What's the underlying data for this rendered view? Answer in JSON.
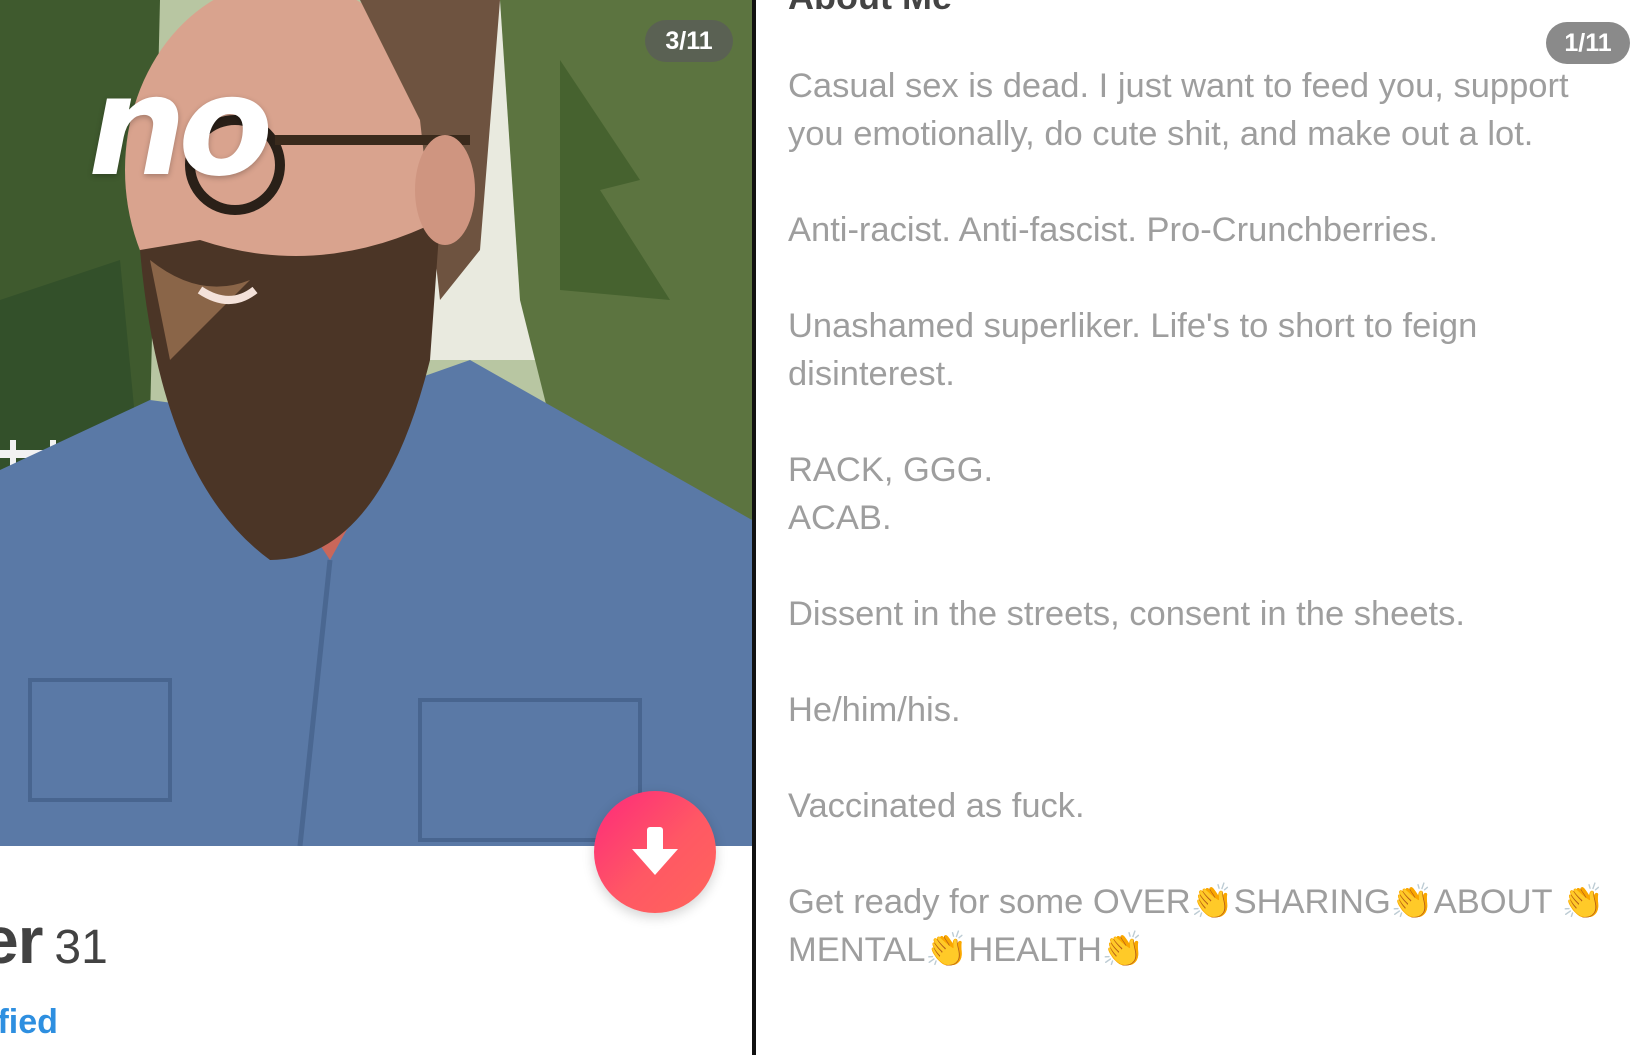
{
  "left_card": {
    "sticker_text": "no",
    "photo_counter": "3/11",
    "name_fragment": "er",
    "age": "31",
    "verified_fragment": "ified"
  },
  "right_card": {
    "heading": "About Me",
    "bio_counter": "1/11",
    "bio_paragraphs": [
      "Casual sex is dead. I just want to feed you, support you emotionally, do cute shit, and make out a lot.",
      "Anti-racist. Anti-fascist. Pro-Crunchberries.",
      "Unashamed superliker. Life's to short to feign disinterest.",
      "RACK, GGG.\nACAB.",
      "Dissent in the streets, consent in the sheets.",
      "He/him/his.",
      "Vaccinated as fuck.",
      "Get ready for some OVER👏SHARING👏ABOUT 👏MENTAL👏HEALTH👏"
    ]
  },
  "colors": {
    "accent_gradient_start": "#fd297b",
    "accent_gradient_end": "#ff655b",
    "verified_blue": "#2e8fe0",
    "bio_text": "#9e9e9e"
  },
  "icons": {
    "down_button": "arrow-down-icon"
  }
}
